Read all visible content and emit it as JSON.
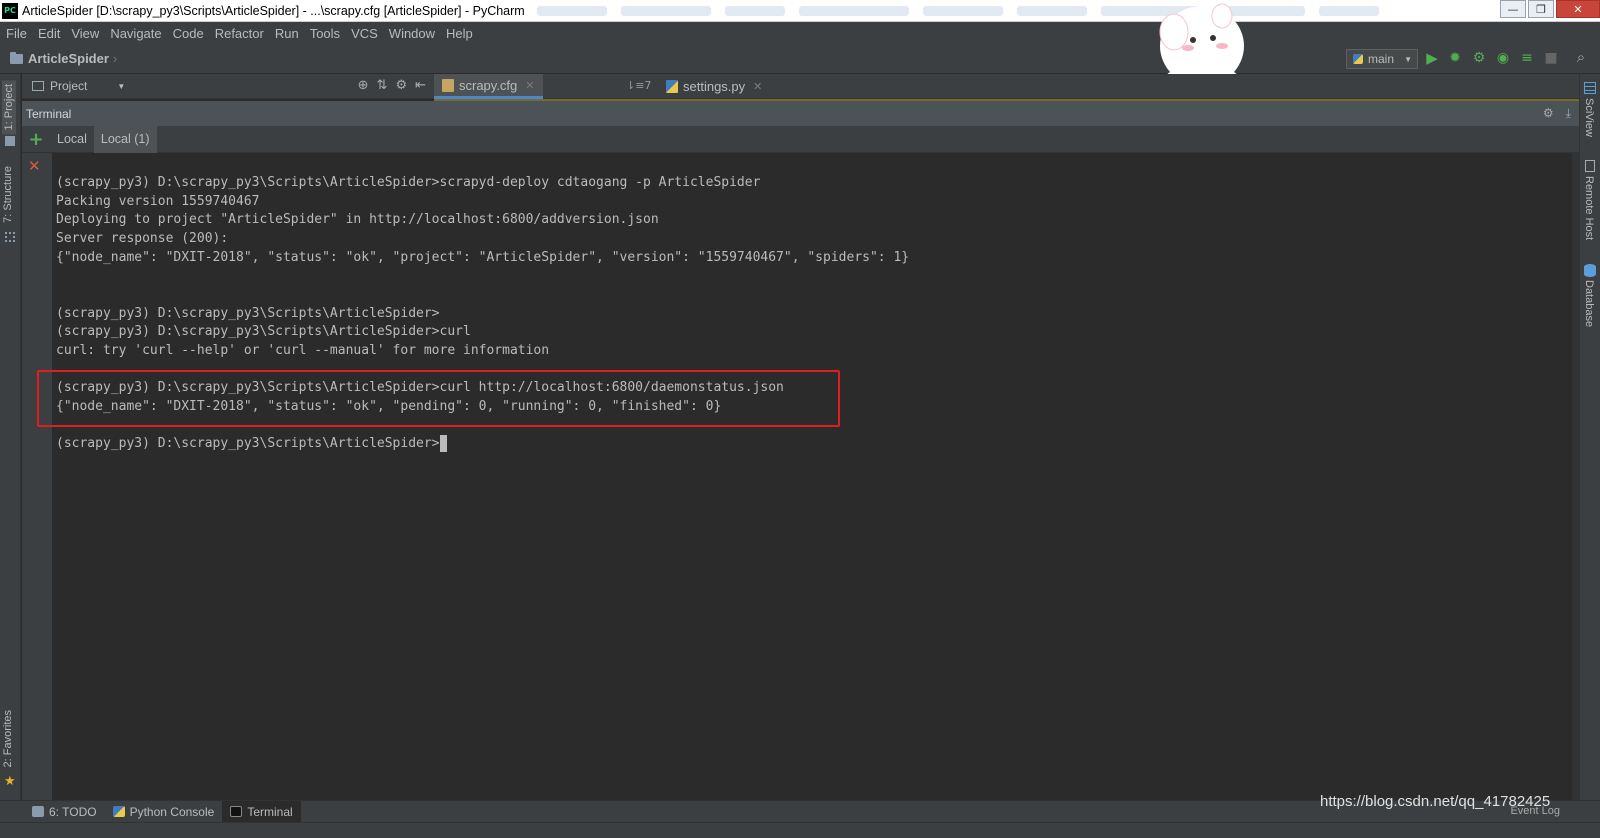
{
  "window": {
    "app_badge": "PC",
    "title": "ArticleSpider [D:\\scrapy_py3\\Scripts\\ArticleSpider] - ...\\scrapy.cfg [ArticleSpider] - PyCharm",
    "minimize": "—",
    "maximize": "❐",
    "close": "✕"
  },
  "menu": [
    "File",
    "Edit",
    "View",
    "Navigate",
    "Code",
    "Refactor",
    "Run",
    "Tools",
    "VCS",
    "Window",
    "Help"
  ],
  "navbar": {
    "project_name": "ArticleSpider",
    "run_config": "main"
  },
  "left_tabs": {
    "project": "1: Project",
    "structure": "7: Structure",
    "favorites": "2: Favorites"
  },
  "right_tabs": {
    "sciview": "SciView",
    "remote_host": "Remote Host",
    "database": "Database"
  },
  "project_panel": {
    "label": "Project"
  },
  "editor_tabs": [
    {
      "label": "scrapy.cfg",
      "active": true
    },
    {
      "label": "settings.py",
      "active": false
    }
  ],
  "tab_split_label": "⇂≡7",
  "terminal": {
    "title": "Terminal",
    "tabs": [
      "Local",
      "Local (1)"
    ],
    "lines": [
      "(scrapy_py3) D:\\scrapy_py3\\Scripts\\ArticleSpider>scrapyd-deploy cdtaogang -p ArticleSpider",
      "Packing version 1559740467",
      "Deploying to project \"ArticleSpider\" in http://localhost:6800/addversion.json",
      "Server response (200):",
      "{\"node_name\": \"DXIT-2018\", \"status\": \"ok\", \"project\": \"ArticleSpider\", \"version\": \"1559740467\", \"spiders\": 1}",
      "(scrapy_py3) D:\\scrapy_py3\\Scripts\\ArticleSpider>",
      "(scrapy_py3) D:\\scrapy_py3\\Scripts\\ArticleSpider>curl",
      "curl: try 'curl --help' or 'curl --manual' for more information",
      "(scrapy_py3) D:\\scrapy_py3\\Scripts\\ArticleSpider>curl http://localhost:6800/daemonstatus.json",
      "{\"node_name\": \"DXIT-2018\", \"status\": \"ok\", \"pending\": 0, \"running\": 0, \"finished\": 0}",
      "(scrapy_py3) D:\\scrapy_py3\\Scripts\\ArticleSpider>"
    ]
  },
  "bottom_tabs": [
    {
      "label": "6: TODO",
      "active": false
    },
    {
      "label": "Python Console",
      "active": false
    },
    {
      "label": "Terminal",
      "active": true
    }
  ],
  "watermark": "https://blog.csdn.net/qq_41782425",
  "event_log": "Event Log",
  "colors": {
    "background": "#2b2b2b",
    "panel": "#3c3f41",
    "text": "#bbbbbb",
    "highlight_box": "#e01e1e",
    "run_green": "#4fae4f"
  }
}
